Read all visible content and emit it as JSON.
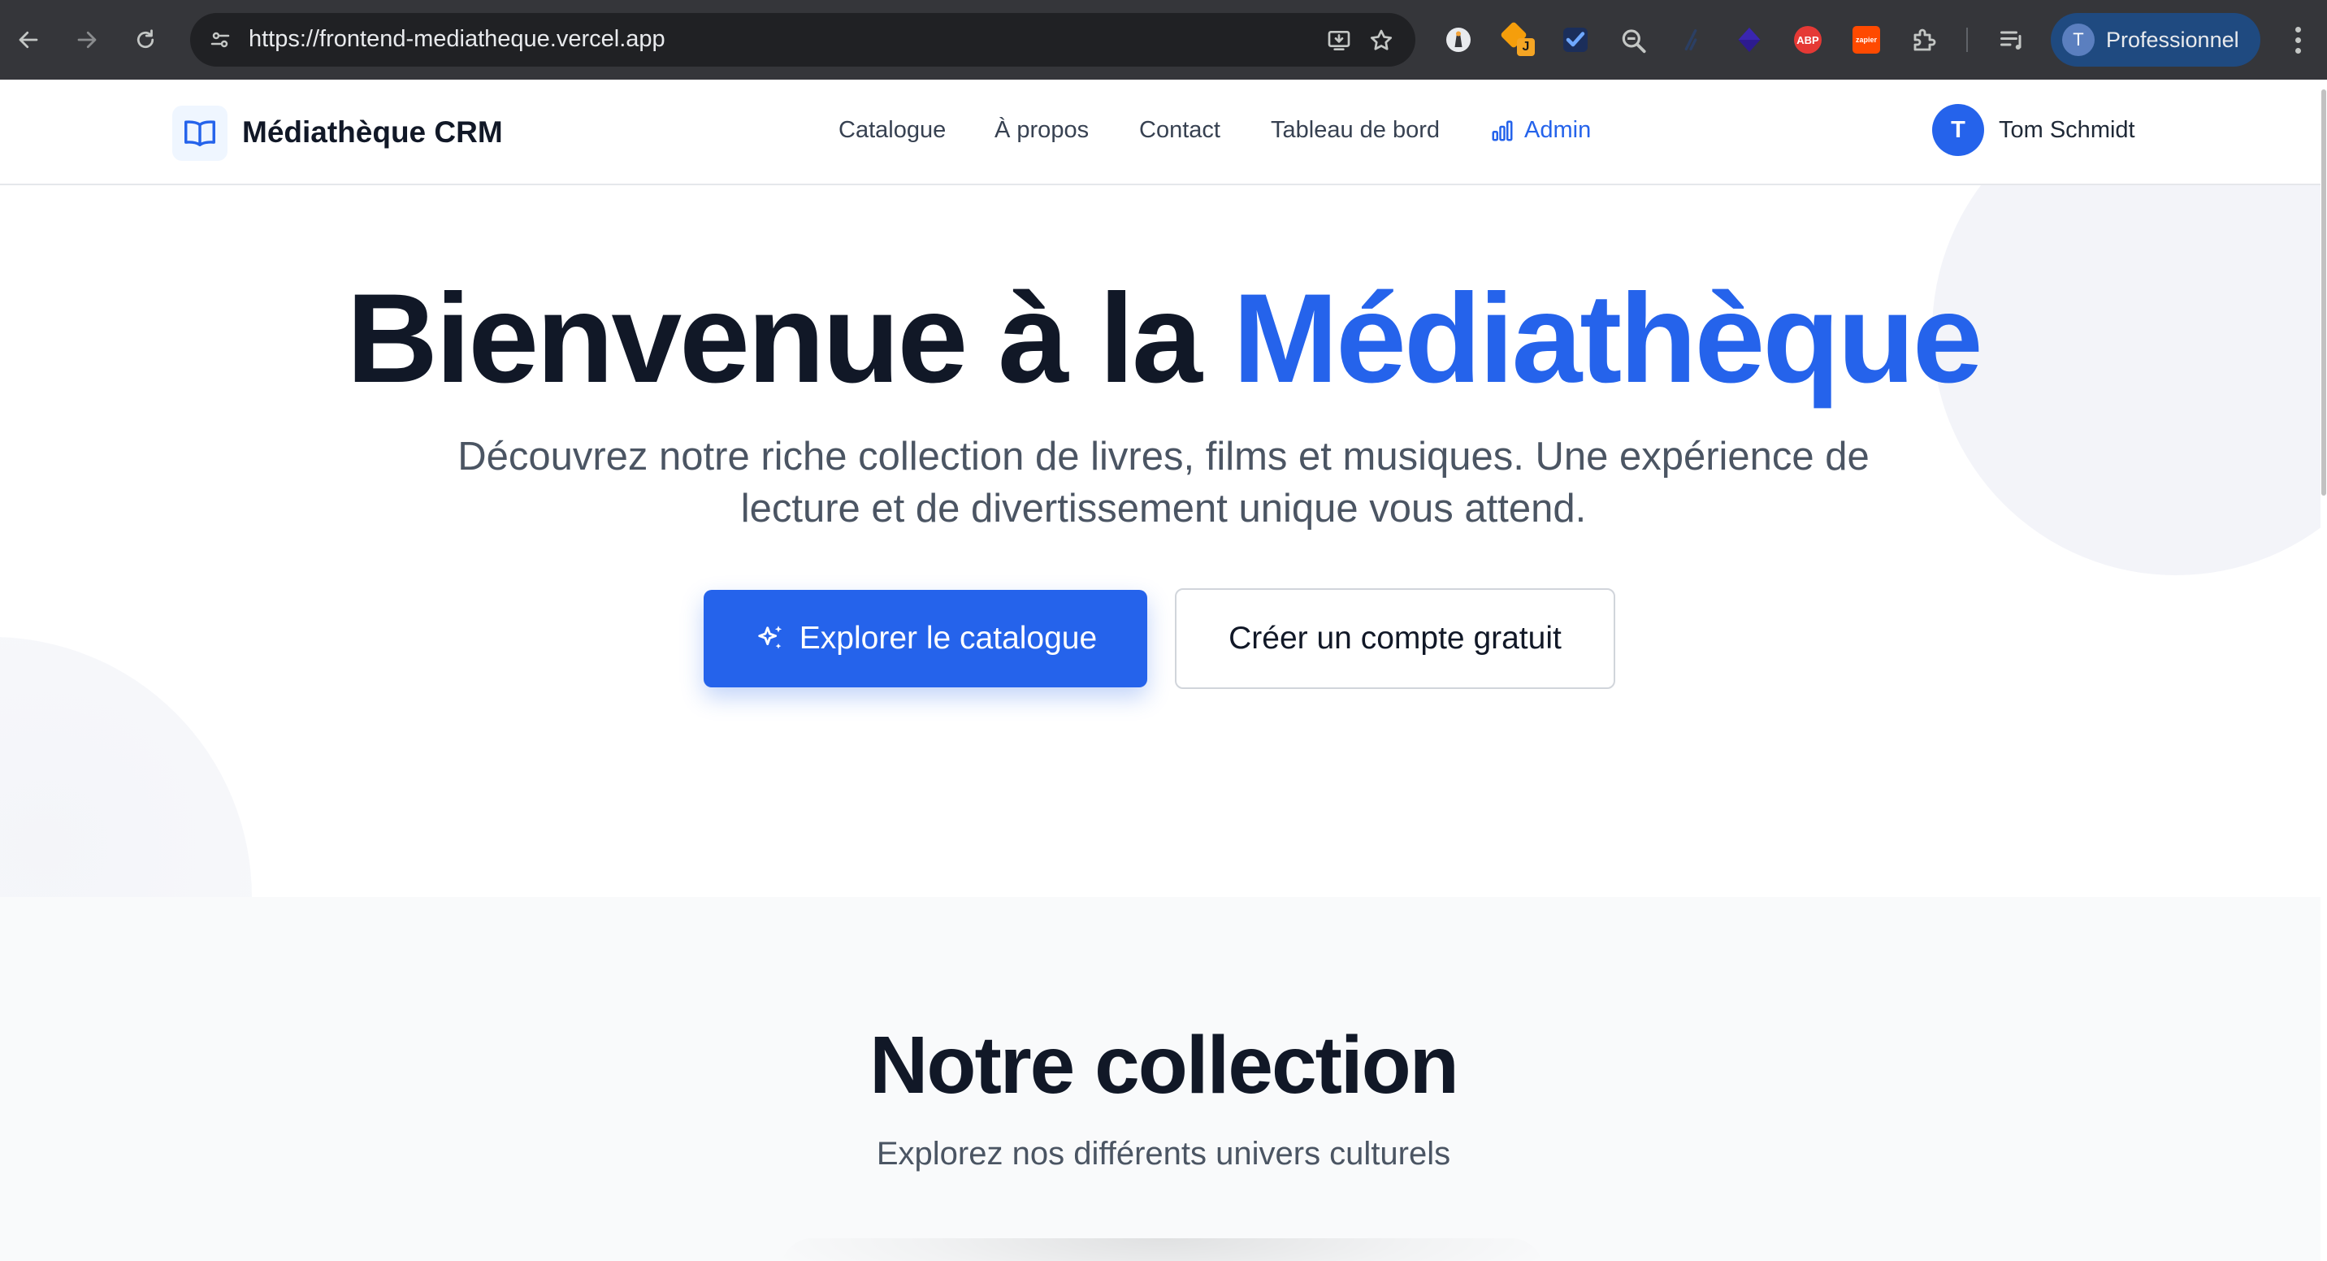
{
  "browser": {
    "url": "https://frontend-mediatheque.vercel.app",
    "profile_initial": "T",
    "profile_label": "Professionnel",
    "extension_badges": {
      "j_badge": "J",
      "abp": "ABP",
      "zapier": "zapier"
    }
  },
  "header": {
    "brand": "Médiathèque CRM",
    "nav": {
      "catalogue": "Catalogue",
      "about": "À propos",
      "contact": "Contact",
      "dashboard": "Tableau de bord",
      "admin": "Admin"
    },
    "user": {
      "initial": "T",
      "name": "Tom Schmidt"
    }
  },
  "hero": {
    "title_main": "Bienvenue à la ",
    "title_accent": "Médiathèque",
    "subtitle": "Découvrez notre riche collection de livres, films et musiques. Une expérience de lecture et de divertissement unique vous attend.",
    "primary_button": "Explorer le catalogue",
    "secondary_button": "Créer un compte gratuit"
  },
  "collection": {
    "title": "Notre collection",
    "subtitle": "Explorez nos différents univers culturels"
  },
  "colors": {
    "accent": "#2563eb",
    "chrome_bg": "#35363a",
    "section_bg": "#f9fafb"
  }
}
